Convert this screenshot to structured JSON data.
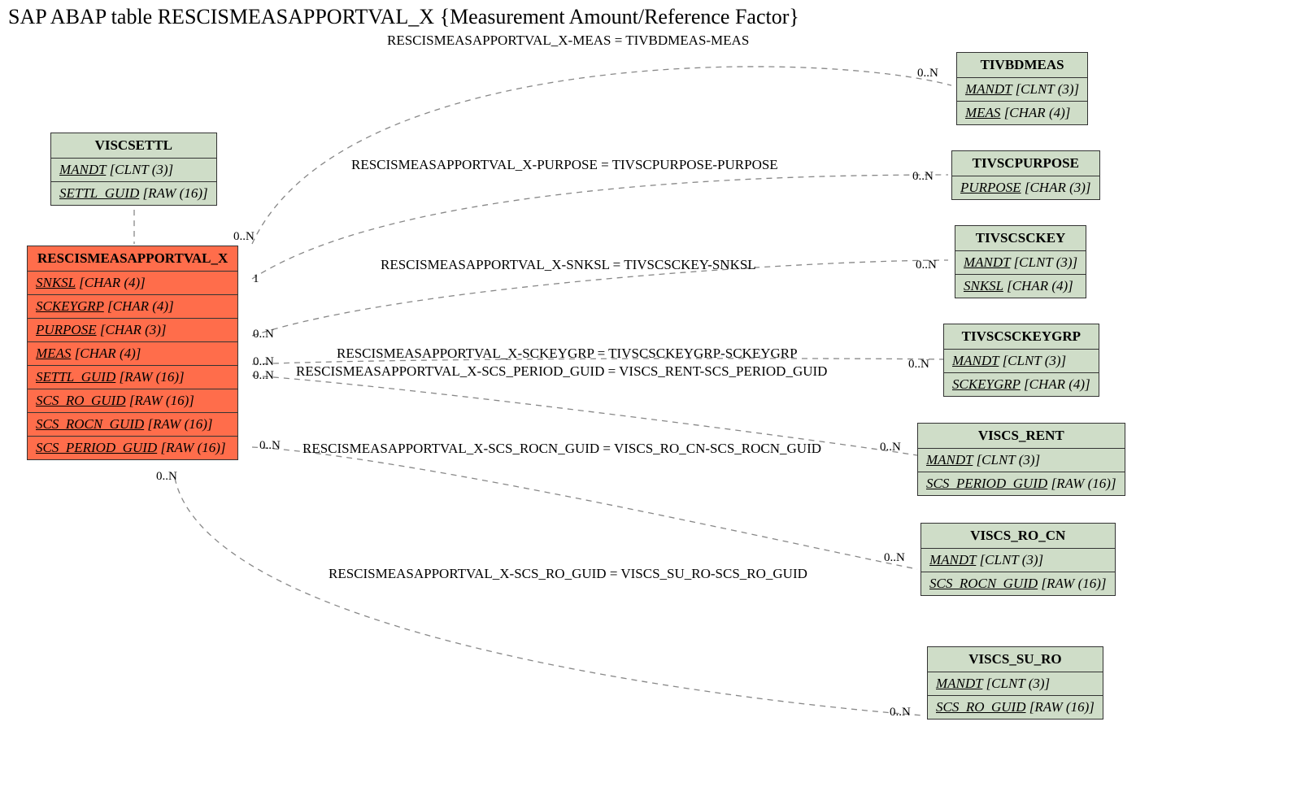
{
  "title": "SAP ABAP table RESCISMEASAPPORTVAL_X {Measurement Amount/Reference Factor}",
  "mainEntity": {
    "name": "RESCISMEASAPPORTVAL_X",
    "fields": [
      {
        "name": "SNKSL",
        "type": "[CHAR (4)]"
      },
      {
        "name": "SCKEYGRP",
        "type": "[CHAR (4)]"
      },
      {
        "name": "PURPOSE",
        "type": "[CHAR (3)]"
      },
      {
        "name": "MEAS",
        "type": "[CHAR (4)]"
      },
      {
        "name": "SETTL_GUID",
        "type": "[RAW (16)]"
      },
      {
        "name": "SCS_RO_GUID",
        "type": "[RAW (16)]"
      },
      {
        "name": "SCS_ROCN_GUID",
        "type": "[RAW (16)]"
      },
      {
        "name": "SCS_PERIOD_GUID",
        "type": "[RAW (16)]"
      }
    ]
  },
  "viscsettl": {
    "name": "VISCSETTL",
    "fields": [
      {
        "name": "MANDT",
        "type": "[CLNT (3)]"
      },
      {
        "name": "SETTL_GUID",
        "type": "[RAW (16)]"
      }
    ]
  },
  "tivbdmeas": {
    "name": "TIVBDMEAS",
    "fields": [
      {
        "name": "MANDT",
        "type": "[CLNT (3)]"
      },
      {
        "name": "MEAS",
        "type": "[CHAR (4)]"
      }
    ]
  },
  "tivscpurpose": {
    "name": "TIVSCPURPOSE",
    "fields": [
      {
        "name": "PURPOSE",
        "type": "[CHAR (3)]"
      }
    ]
  },
  "tivscsckey": {
    "name": "TIVSCSCKEY",
    "fields": [
      {
        "name": "MANDT",
        "type": "[CLNT (3)]"
      },
      {
        "name": "SNKSL",
        "type": "[CHAR (4)]"
      }
    ]
  },
  "tivscsckeygrp": {
    "name": "TIVSCSCKEYGRP",
    "fields": [
      {
        "name": "MANDT",
        "type": "[CLNT (3)]"
      },
      {
        "name": "SCKEYGRP",
        "type": "[CHAR (4)]"
      }
    ]
  },
  "viscs_rent": {
    "name": "VISCS_RENT",
    "fields": [
      {
        "name": "MANDT",
        "type": "[CLNT (3)]"
      },
      {
        "name": "SCS_PERIOD_GUID",
        "type": "[RAW (16)]"
      }
    ]
  },
  "viscs_ro_cn": {
    "name": "VISCS_RO_CN",
    "fields": [
      {
        "name": "MANDT",
        "type": "[CLNT (3)]"
      },
      {
        "name": "SCS_ROCN_GUID",
        "type": "[RAW (16)]"
      }
    ]
  },
  "viscs_su_ro": {
    "name": "VISCS_SU_RO",
    "fields": [
      {
        "name": "MANDT",
        "type": "[CLNT (3)]"
      },
      {
        "name": "SCS_RO_GUID",
        "type": "[RAW (16)]"
      }
    ]
  },
  "relations": {
    "r1": "RESCISMEASAPPORTVAL_X-MEAS = TIVBDMEAS-MEAS",
    "r2": "RESCISMEASAPPORTVAL_X-PURPOSE = TIVSCPURPOSE-PURPOSE",
    "r3": "RESCISMEASAPPORTVAL_X-SNKSL = TIVSCSCKEY-SNKSL",
    "r4": "RESCISMEASAPPORTVAL_X-SCKEYGRP = TIVSCSCKEYGRP-SCKEYGRP",
    "r5": "RESCISMEASAPPORTVAL_X-SCS_PERIOD_GUID = VISCS_RENT-SCS_PERIOD_GUID",
    "r6": "RESCISMEASAPPORTVAL_X-SCS_ROCN_GUID = VISCS_RO_CN-SCS_ROCN_GUID",
    "r7": "RESCISMEASAPPORTVAL_X-SCS_RO_GUID = VISCS_SU_RO-SCS_RO_GUID"
  },
  "cards": {
    "zn": "0..N",
    "one": "1"
  }
}
